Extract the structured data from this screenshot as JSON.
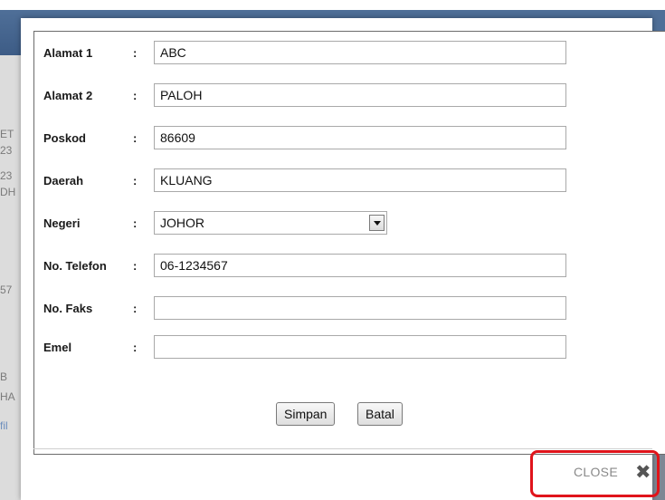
{
  "form": {
    "rows": [
      {
        "label": "Alamat 1",
        "colon": ":",
        "value": "ABC"
      },
      {
        "label": "Alamat 2",
        "colon": ":",
        "value": "PALOH"
      },
      {
        "label": "Poskod",
        "colon": ":",
        "value": "86609"
      },
      {
        "label": "Daerah",
        "colon": ":",
        "value": "KLUANG"
      },
      {
        "label": "Negeri",
        "colon": ":",
        "value": "JOHOR"
      },
      {
        "label": "No. Telefon",
        "colon": ":",
        "value": "06-1234567"
      },
      {
        "label": "No. Faks",
        "colon": ":",
        "value": ""
      },
      {
        "label": "Emel",
        "colon": ":",
        "value": ""
      }
    ],
    "save_label": "Simpan",
    "cancel_label": "Batal"
  },
  "modal": {
    "close_label": "CLOSE",
    "close_icon": "✖",
    "highlight_color": "#e0141b"
  },
  "background": {
    "fragments": [
      "ET",
      "23",
      "23",
      "DH",
      "57",
      "B",
      "HA",
      "fil"
    ]
  }
}
